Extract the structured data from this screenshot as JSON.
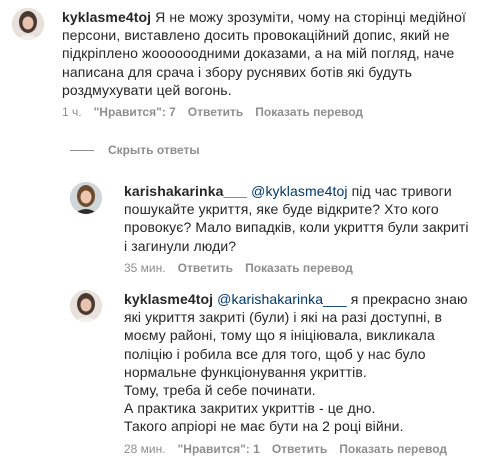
{
  "comments": [
    {
      "username": "kyklasme4toj",
      "mention": "",
      "text": "Я не можу зрозуміти, чому на сторінці медійної персони, виставлено досить провокаційний допис, який не підкріплено жоооооодними доказами, а на мій погляд, наче написана для срача і збору руснявих ботів які будуть роздмухувати цей вогонь.",
      "time": "1 ч.",
      "likes": "\"Нравится\": 7",
      "reply": "Ответить",
      "translate": "Показать перевод"
    },
    {
      "username": "karishakarinka___",
      "mention": "@kyklasme4toj",
      "text": "під час тривоги пошукайте укриття, яке буде відкрите? Хто кого провокує? Мало випадків, коли укриття були закриті і загинули люди?",
      "time": "35 мин.",
      "reply": "Ответить",
      "translate": "Показать перевод"
    },
    {
      "username": "kyklasme4toj",
      "mention": "@karishakarinka___",
      "text": "я прекрасно знаю які укриття закриті (були) і які на разі доступні, в моєму районі, тому що я ініціювала, викликала поліцію і робила все для того, щоб у нас було нормальне функціонування укриттів.",
      "text_lines": [
        "Тому, треба й себе починати.",
        "А практика закритих укриттів - це дно.",
        "Такого апріорі не має бути на 2 році війни."
      ],
      "time": "28 мин.",
      "likes": "\"Нравится\": 1",
      "reply": "Ответить",
      "translate": "Показать перевод"
    }
  ],
  "hide_replies": "Скрыть ответы",
  "icons": {
    "avatar1": "avatar-icon",
    "avatar2": "avatar-icon",
    "avatar3": "avatar-icon"
  }
}
